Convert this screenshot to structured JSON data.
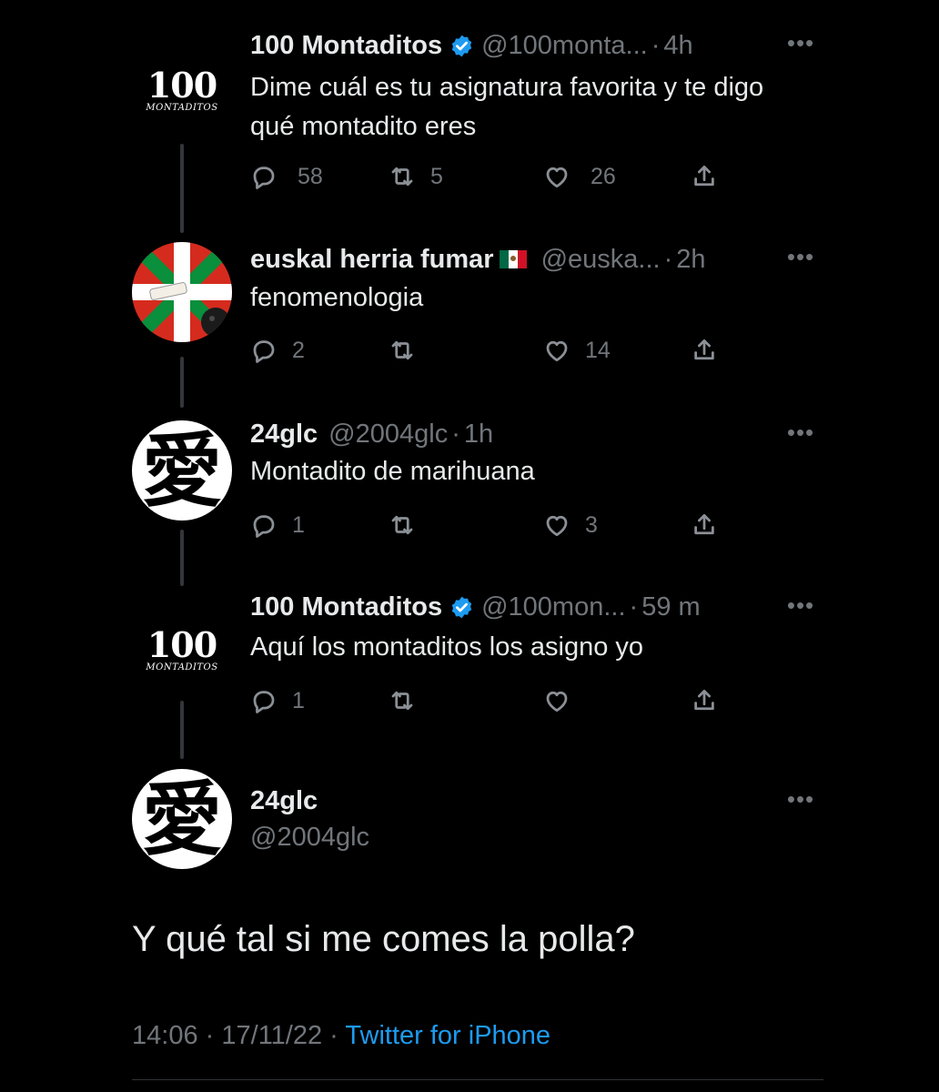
{
  "tweets": [
    {
      "name": "100 Montaditos",
      "handle": "@100monta...",
      "time": "4h",
      "text": "Dime cuál es tu asignatura favorita y te digo qué montadito eres",
      "replies": "58",
      "retweets": "5",
      "likes": "26",
      "avatar": {
        "type": "logo",
        "big": "100",
        "small": "MONTADITOS"
      }
    },
    {
      "name": "euskal herria fumar",
      "handle": "@euska...",
      "time": "2h",
      "text": "fenomenologia",
      "replies": "2",
      "retweets": "",
      "likes": "14",
      "flag_colors": [
        "#006847",
        "#ffffff",
        "#ce1126"
      ]
    },
    {
      "name": "24glc",
      "handle": "@2004glc",
      "time": "1h",
      "text": "Montadito de marihuana",
      "replies": "1",
      "retweets": "",
      "likes": "3",
      "avatar": {
        "type": "kanji",
        "char": "愛"
      }
    },
    {
      "name": "100 Montaditos",
      "handle": "@100mon...",
      "time": "59 m",
      "text": "Aquí los montaditos los asigno yo",
      "replies": "1",
      "retweets": "",
      "likes": "",
      "avatar": {
        "type": "logo",
        "big": "100",
        "small": "MONTADITOS"
      }
    }
  ],
  "main_tweet": {
    "name": "24glc",
    "handle": "@2004glc",
    "text": "Y qué tal si me comes la polla?",
    "time": "14:06",
    "date": "17/11/22",
    "source": "Twitter for iPhone",
    "avatar": {
      "type": "kanji",
      "char": "愛"
    }
  },
  "separator": "·",
  "more_glyph": "•••",
  "colors": {
    "background": "#000000",
    "text": "#e7e9ea",
    "secondary": "#71767b",
    "accent": "#1d9bf0",
    "verified": "#1d9bf0"
  },
  "icons": [
    "reply-icon",
    "retweet-icon",
    "like-icon",
    "share-icon",
    "verified-badge-icon",
    "more-icon"
  ]
}
